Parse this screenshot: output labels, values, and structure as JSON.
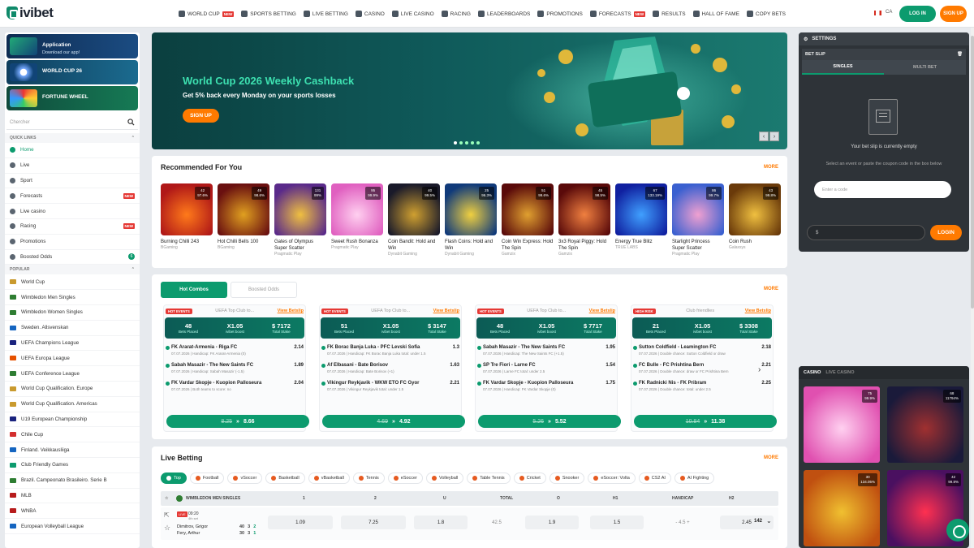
{
  "brand": "ivibet",
  "nav": [
    {
      "label": "WORLD CUP",
      "icon": "trophy-icon",
      "badge": "NEW"
    },
    {
      "label": "SPORTS BETTING",
      "icon": "soccer-icon"
    },
    {
      "label": "LIVE BETTING",
      "icon": "live-icon"
    },
    {
      "label": "CASINO",
      "icon": "casino-icon"
    },
    {
      "label": "LIVE CASINO",
      "icon": "live-casino-icon"
    },
    {
      "label": "RACING",
      "icon": "horse-icon"
    },
    {
      "label": "LEADERBOARDS",
      "icon": "leaderboard-icon"
    },
    {
      "label": "PROMOTIONS",
      "icon": "gift-icon"
    },
    {
      "label": "FORECASTS",
      "icon": "forecast-icon",
      "badge": "NEW"
    },
    {
      "label": "RESULTS",
      "icon": "results-icon"
    },
    {
      "label": "HALL OF FAME",
      "icon": "fame-icon"
    },
    {
      "label": "COPY BETS",
      "icon": "copy-icon"
    }
  ],
  "lang": "CA",
  "login": "LOG IN",
  "signup": "SIGN UP",
  "sidebar": {
    "promos": [
      {
        "title": "Application",
        "sub": "Download our app!"
      },
      {
        "title": "WORLD CUP 26",
        "sub": ""
      },
      {
        "title": "FORTUNE WHEEL",
        "sub": ""
      }
    ],
    "search_placeholder": "Chercher",
    "quick_links_title": "QUICK LINKS",
    "quick_links": [
      {
        "label": "Home"
      },
      {
        "label": "Live"
      },
      {
        "label": "Sport"
      },
      {
        "label": "Forecasts",
        "badge": "NEW"
      },
      {
        "label": "Live casino"
      },
      {
        "label": "Racing",
        "badge": "NEW"
      },
      {
        "label": "Promotions"
      },
      {
        "label": "Boosted Odds",
        "count": "6"
      }
    ],
    "popular_title": "POPULAR",
    "popular": [
      {
        "label": "World Cup",
        "flag": "#c99a2e"
      },
      {
        "label": "Wimbledon Men Singles",
        "flag": "#2e7d32"
      },
      {
        "label": "Wimbledon Women Singles",
        "flag": "#2e7d32"
      },
      {
        "label": "Sweden. Allsvenskan",
        "flag": "#1565c0"
      },
      {
        "label": "UEFA Champions League",
        "flag": "#1a237e"
      },
      {
        "label": "UEFA Europa League",
        "flag": "#e65100"
      },
      {
        "label": "UEFA Conference League",
        "flag": "#2e7d32"
      },
      {
        "label": "World Cup Qualification. Europe",
        "flag": "#c99a2e"
      },
      {
        "label": "World Cup Qualification. Americas",
        "flag": "#c99a2e"
      },
      {
        "label": "U19 European Championship",
        "flag": "#1a237e"
      },
      {
        "label": "Chile Cup",
        "flag": "#d32f2f"
      },
      {
        "label": "Finland. Veikkausliiga",
        "flag": "#1565c0"
      },
      {
        "label": "Club Friendly Games",
        "flag": "#0c9b6e"
      },
      {
        "label": "Brazil. Campeonato Brasileiro. Serie B",
        "flag": "#2e7d32"
      },
      {
        "label": "MLB",
        "flag": "#b71c1c"
      },
      {
        "label": "WNBA",
        "flag": "#b71c1c"
      },
      {
        "label": "European Volleyball League",
        "flag": "#1565c0"
      }
    ]
  },
  "hero": {
    "title": "World Cup 2026 Weekly Cashback",
    "subtitle": "Get 5% back every Monday on your sports losses",
    "button": "SIGN UP"
  },
  "recommended": {
    "title": "Recommended For You",
    "more": "MORE",
    "games": [
      {
        "name": "Burning Chilli 243",
        "provider": "BGaming",
        "players": "42",
        "rtp": "97.6%",
        "c1": "#b01818",
        "c2": "#ff7a1a"
      },
      {
        "name": "Hot Chilli Bells 100",
        "provider": "BGaming",
        "players": "49",
        "rtp": "98.6%",
        "c1": "#6a1010",
        "c2": "#e0a020"
      },
      {
        "name": "Gates of Olympus Super Scatter",
        "provider": "Pragmatic Play",
        "players": "131",
        "rtp": "99%",
        "c1": "#5a2a8a",
        "c2": "#f0c040"
      },
      {
        "name": "Sweet Rush Bonanza",
        "provider": "Pragmatic Play",
        "players": "95",
        "rtp": "99.9%",
        "c1": "#e060c0",
        "c2": "#ffd0f0"
      },
      {
        "name": "Coin Bandit: Hold and Win",
        "provider": "Dynabit Gaming",
        "players": "40",
        "rtp": "99.5%",
        "c1": "#1a1a2a",
        "c2": "#d0a030"
      },
      {
        "name": "Flash Coins: Hold and Win",
        "provider": "Dynabit Gaming",
        "players": "25",
        "rtp": "96.3%",
        "c1": "#103a7a",
        "c2": "#f0d040"
      },
      {
        "name": "Coin Win Express: Hold The Spin",
        "provider": "Gamzix",
        "players": "51",
        "rtp": "99.6%",
        "c1": "#5a0a0a",
        "c2": "#e0a030"
      },
      {
        "name": "3x3 Royal Piggy: Hold The Spin",
        "provider": "Gamzix",
        "players": "45",
        "rtp": "98.5%",
        "c1": "#5a0a0a",
        "c2": "#f08040"
      },
      {
        "name": "Energy True Blitz",
        "provider": "TRUE LABS",
        "players": "67",
        "rtp": "133.19%",
        "c1": "#1020a0",
        "c2": "#40a0ff"
      },
      {
        "name": "Starlight Princess Super Scatter",
        "provider": "Pragmatic Play",
        "players": "86",
        "rtp": "99.7%",
        "c1": "#3a60d0",
        "c2": "#f0a0d0"
      },
      {
        "name": "Coin Rush",
        "provider": "Galaxsys",
        "players": "43",
        "rtp": "99.8%",
        "c1": "#6a3a0a",
        "c2": "#f0c040"
      }
    ]
  },
  "combos": {
    "tab_active": "Hot Combos",
    "tab_other": "Boosted Odds",
    "more": "MORE",
    "view_label": "View Betslip",
    "bets_label": "Bets Placed",
    "boost_label": "ivibet boost",
    "stake_label": "Total Stake",
    "cards": [
      {
        "tag": "HOT EVENTS",
        "league": "UEFA Top Club to...",
        "bets": "48",
        "boost": "X1.05",
        "stake": "$ 7172",
        "old": "8.25",
        "new": "8.66",
        "legs": [
          {
            "m": "FK Ararat-Armenia - Riga FC",
            "o": "2.14",
            "s": "07.07.2026 | Handicap: FK Ararat-Armenia (0)"
          },
          {
            "m": "Sabah Masazir - The New Saints FC",
            "o": "1.89",
            "s": "07.07.2026 | Handicap: Sabah Masazir (-1.5)"
          },
          {
            "m": "FK Vardar Skopje - Kuopion Palloseura",
            "o": "2.04",
            "s": "07.07.2026 | Both teams to score: no"
          }
        ]
      },
      {
        "tag": "HOT EVENTS",
        "league": "UEFA Top Club to...",
        "bets": "51",
        "boost": "X1.05",
        "stake": "$ 3147",
        "old": "4.69",
        "new": "4.92",
        "legs": [
          {
            "m": "FK Borac Banja Luka - PFC Levski Sofia",
            "o": "1.3",
            "s": "07.07.2026 | Handicap: FK Borac Banja Luka total: under 1.5"
          },
          {
            "m": "Af Elbasani - Bate Borisov",
            "o": "1.63",
            "s": "07.07.2026 | Handicap: Bate Borisov (+1)"
          },
          {
            "m": "Vikingur Reykjavik - WKW ETO FC Gyor",
            "o": "2.21",
            "s": "07.07.2026 | Vikingur Reykjavik total: under 1.5"
          }
        ]
      },
      {
        "tag": "HOT EVENTS",
        "league": "UEFA Top Club to...",
        "bets": "48",
        "boost": "X1.05",
        "stake": "$ 7717",
        "old": "5.26",
        "new": "5.52",
        "legs": [
          {
            "m": "Sabah Masazir - The New Saints FC",
            "o": "1.95",
            "s": "07.07.2026 | Handicap: The New Saints FC (+1.5)"
          },
          {
            "m": "SP Tre Fiori - Larne FC",
            "o": "1.54",
            "s": "07.07.2026 | Larne FC total: under 2.5"
          },
          {
            "m": "FK Vardar Skopje - Kuopion Palloseura",
            "o": "1.75",
            "s": "07.07.2026 | Handicap: FK Vardar Skopje (0)"
          }
        ]
      },
      {
        "tag": "HIGH RISK",
        "league": "Club friendlies",
        "bets": "21",
        "boost": "X1.05",
        "stake": "$ 3308",
        "old": "10.84",
        "new": "11.38",
        "legs": [
          {
            "m": "Sutton Coldfield - Leamington FC",
            "o": "2.18",
            "s": "07.07.2026 | Double chance: Sutton Coldfield or draw"
          },
          {
            "m": "FC Bulle - FC Prishtina Bern",
            "o": "2.21",
            "s": "07.07.2026 | Double chance: draw or FC Prishtina Bern"
          },
          {
            "m": "FK Radnicki Nis - FK Pribram",
            "o": "2.25",
            "s": "07.07.2026 | Double chance: total: under 2.5"
          }
        ]
      }
    ]
  },
  "live": {
    "title": "Live Betting",
    "more": "MORE",
    "sports": [
      "Top",
      "Football",
      "vSoccer",
      "Basketball",
      "vBasketball",
      "Tennis",
      "eSoccer",
      "Volleyball",
      "Table Tennis",
      "Cricket",
      "Snooker",
      "eSoccer: Volta",
      "CS2 AI",
      "AI Fighting"
    ],
    "league": "WIMBLEDON MEN SINGLES",
    "cols": [
      "1",
      "2",
      "U",
      "TOTAL",
      "O",
      "H1",
      "HANDICAP",
      "H2"
    ],
    "match": {
      "time": "09:20",
      "set": "4th set",
      "p1": "Dimitrov, Grigor",
      "p2": "Fery, Arthur",
      "s1a": "40",
      "s1b": "3",
      "s1c": "2",
      "s2a": "30",
      "s2b": "3",
      "s2c": "1",
      "odds": [
        "1.09",
        "7.25",
        "1.8",
        "42.5",
        "1.9",
        "1.5",
        "- 4.5 +",
        "2.45"
      ],
      "markets": "142"
    }
  },
  "betslip": {
    "settings": "SETTINGS",
    "title": "BET SLIP",
    "tab1": "SINGLES",
    "tab2": "MULTI BET",
    "empty": "Your bet slip is currently empty",
    "hint": "Select an event or paste the coupon code in the box below",
    "code_placeholder": "Enter a code",
    "currency": "$",
    "login": "LOGIN"
  },
  "casino": {
    "tab1": "CASINO",
    "tab2": "LIVE CASINO",
    "games": [
      {
        "players": "75",
        "rtp": "99.9%",
        "c1": "#e050b0",
        "c2": "#ffd0f0"
      },
      {
        "players": "68",
        "rtp": "11794%",
        "c1": "#1a1a3a",
        "c2": "#a03030"
      },
      {
        "players": "30",
        "rtp": "134.05%",
        "c1": "#c05010",
        "c2": "#f0c030"
      },
      {
        "players": "42",
        "rtp": "99.8%",
        "c1": "#4a1060",
        "c2": "#ff3050"
      }
    ]
  }
}
